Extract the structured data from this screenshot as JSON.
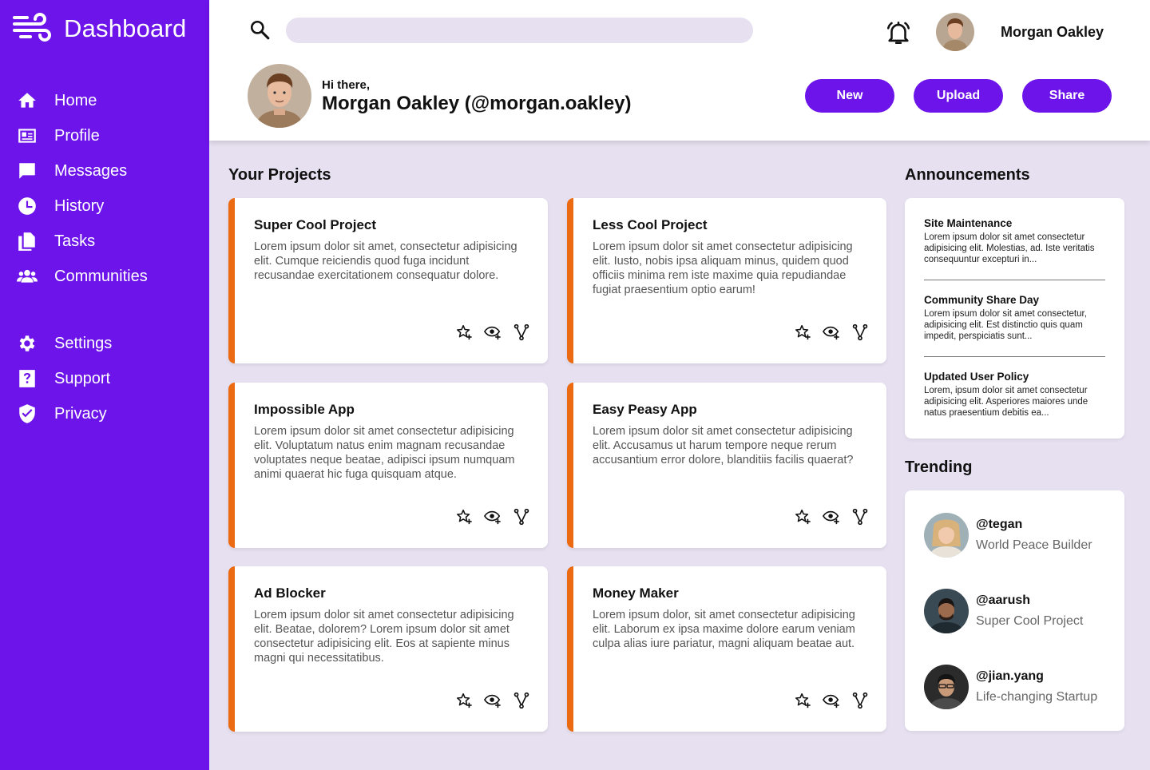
{
  "sidebar": {
    "title": "Dashboard",
    "nav": [
      {
        "label": "Home",
        "icon": "home-icon"
      },
      {
        "label": "Profile",
        "icon": "id-card-icon"
      },
      {
        "label": "Messages",
        "icon": "message-icon"
      },
      {
        "label": "History",
        "icon": "clock-icon"
      },
      {
        "label": "Tasks",
        "icon": "documents-icon"
      },
      {
        "label": "Communities",
        "icon": "people-icon"
      }
    ],
    "nav2": [
      {
        "label": "Settings",
        "icon": "gear-icon"
      },
      {
        "label": "Support",
        "icon": "help-icon"
      },
      {
        "label": "Privacy",
        "icon": "shield-icon"
      }
    ]
  },
  "header": {
    "search_placeholder": "",
    "user_name": "Morgan Oakley",
    "greeting": "Hi there,",
    "full_greeting": "Morgan Oakley (@morgan.oakley)",
    "buttons": {
      "new": "New",
      "upload": "Upload",
      "share": "Share"
    }
  },
  "projects": {
    "title": "Your Projects",
    "items": [
      {
        "title": "Super Cool Project",
        "text": "Lorem ipsum dolor sit amet, consectetur adipisicing elit. Cumque reiciendis quod fuga incidunt recusandae exercitationem consequatur dolore."
      },
      {
        "title": "Less Cool Project",
        "text": "Lorem ipsum dolor sit amet consectetur adipisicing elit. Iusto, nobis ipsa aliquam minus, quidem quod officiis minima rem iste maxime quia repudiandae fugiat praesentium optio earum!"
      },
      {
        "title": "Impossible App",
        "text": "Lorem ipsum dolor sit amet consectetur adipisicing elit. Voluptatum natus enim magnam recusandae voluptates neque beatae, adipisci ipsum numquam animi quaerat hic fuga quisquam atque."
      },
      {
        "title": "Easy Peasy App",
        "text": "Lorem ipsum dolor sit amet consectetur adipisicing elit. Accusamus ut harum tempore neque rerum accusantium error dolore, blanditiis facilis quaerat?"
      },
      {
        "title": "Ad Blocker",
        "text": "Lorem ipsum dolor sit amet consectetur adipisicing elit. Beatae, dolorem? Lorem ipsum dolor sit amet consectetur adipisicing elit. Eos at sapiente minus magni qui necessitatibus."
      },
      {
        "title": "Money Maker",
        "text": "Lorem ipsum dolor, sit amet consectetur adipisicing elit. Laborum ex ipsa maxime dolore earum veniam culpa alias iure pariatur, magni aliquam beatae aut."
      }
    ]
  },
  "announcements": {
    "title": "Announcements",
    "items": [
      {
        "title": "Site Maintenance",
        "text": "Lorem ipsum dolor sit amet consectetur adipisicing elit. Molestias, ad. Iste veritatis consequuntur excepturi in..."
      },
      {
        "title": "Community Share Day",
        "text": "Lorem ipsum dolor sit amet consectetur, adipisicing elit. Est distinctio quis quam impedit, perspiciatis sunt..."
      },
      {
        "title": "Updated User Policy",
        "text": "Lorem, ipsum dolor sit amet consectetur adipisicing elit. Asperiores maiores unde natus praesentium debitis ea..."
      }
    ]
  },
  "trending": {
    "title": "Trending",
    "items": [
      {
        "handle": "@tegan",
        "project": "World Peace Builder"
      },
      {
        "handle": "@aarush",
        "project": "Super Cool Project"
      },
      {
        "handle": "@jian.yang",
        "project": "Life-changing Startup"
      }
    ]
  },
  "colors": {
    "accent": "#6d14ea",
    "card_border": "#ec6a12",
    "background": "#e6e0f0"
  }
}
